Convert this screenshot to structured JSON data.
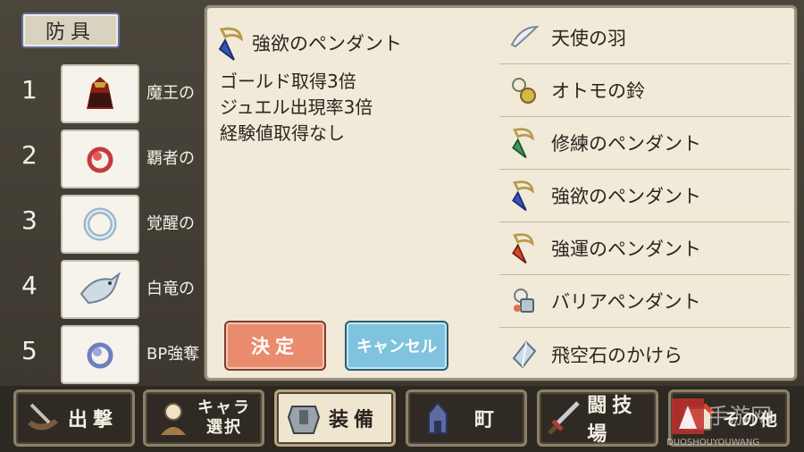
{
  "category": {
    "label": "防具"
  },
  "armor_list": [
    {
      "num": "1",
      "name": "魔王の",
      "icon": "demon-cape-icon"
    },
    {
      "num": "2",
      "name": "覇者の",
      "icon": "conqueror-amulet-icon"
    },
    {
      "num": "3",
      "name": "覚醒の",
      "icon": "awakening-ring-icon"
    },
    {
      "num": "4",
      "name": "白竜の",
      "icon": "white-dragon-icon"
    },
    {
      "num": "5",
      "name": "BP強奪",
      "icon": "bp-steal-amulet-icon"
    }
  ],
  "detail": {
    "title": "強欲のペンダント",
    "icon": "greed-pendant-icon",
    "lines": [
      "ゴールド取得3倍",
      "ジュエル出現率3倍",
      "経験値取得なし"
    ]
  },
  "buttons": {
    "confirm": "決定",
    "cancel": "キャンセル"
  },
  "items": [
    {
      "label": "天使の羽",
      "icon": "angel-feather-icon"
    },
    {
      "label": "オトモの鈴",
      "icon": "companion-bell-icon"
    },
    {
      "label": "修練のペンダント",
      "icon": "training-pendant-icon"
    },
    {
      "label": "強欲のペンダント",
      "icon": "greed-pendant-icon"
    },
    {
      "label": "強運のペンダント",
      "icon": "luck-pendant-icon"
    },
    {
      "label": "バリアペンダント",
      "icon": "barrier-pendant-icon"
    },
    {
      "label": "飛空石のかけら",
      "icon": "flying-stone-icon"
    }
  ],
  "nav": [
    {
      "label": "出撃",
      "icon": "sortie-icon"
    },
    {
      "label": "キャラ選択",
      "line1": "キャラ",
      "line2": "選択",
      "icon": "character-icon"
    },
    {
      "label": "装備",
      "icon": "armor-icon",
      "active": true
    },
    {
      "label": "町",
      "icon": "town-icon"
    },
    {
      "label": "闘技場",
      "icon": "sword-icon"
    },
    {
      "label": "その他",
      "icon": "other-icon"
    }
  ],
  "watermark": {
    "text": "DUOSHOUYOUWANG"
  },
  "colors": {
    "confirm": "#e98c6e",
    "cancel": "#7fc3de",
    "panel": "#f1ead9"
  }
}
